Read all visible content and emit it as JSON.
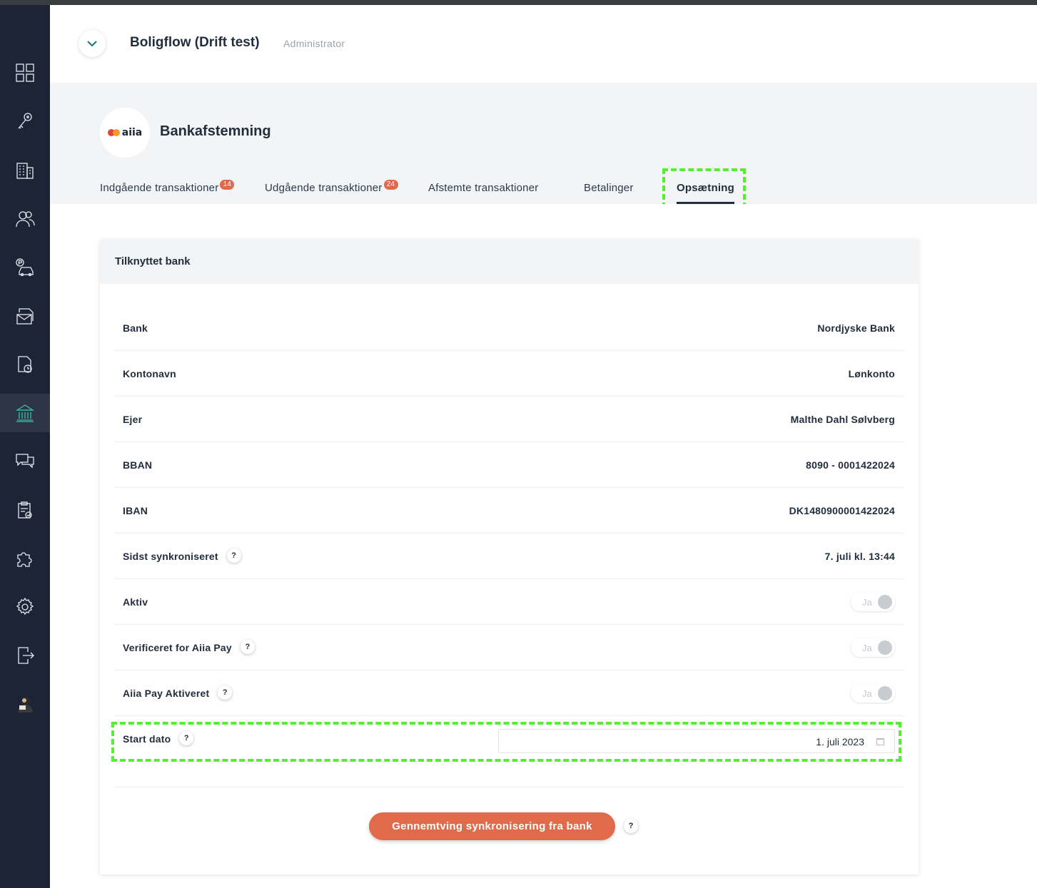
{
  "header": {
    "title": "Boligflow (Drift test)",
    "role": "Administrator"
  },
  "page": {
    "title": "Bankafstemning",
    "logo_text": "aiia",
    "brand_colors": {
      "dot1": "#e0453a",
      "dot2": "#f39a2b",
      "accent": "#df6a4c",
      "highlight": "#55ee33"
    }
  },
  "sidebar": {
    "items": [
      {
        "icon": "dashboard-grid-icon"
      },
      {
        "icon": "keys-icon"
      },
      {
        "icon": "building-icon"
      },
      {
        "icon": "users-icon"
      },
      {
        "icon": "parking-car-icon"
      },
      {
        "icon": "mail-stack-icon"
      },
      {
        "icon": "document-clock-icon"
      },
      {
        "icon": "bank-icon",
        "active": true
      },
      {
        "icon": "chat-icon"
      },
      {
        "icon": "clipboard-check-icon"
      },
      {
        "icon": "puzzle-icon"
      },
      {
        "icon": "gear-icon"
      },
      {
        "icon": "logout-icon"
      },
      {
        "icon": "avatar"
      }
    ]
  },
  "tabs": [
    {
      "label": "Indgående transaktioner",
      "badge": "14"
    },
    {
      "label": "Udgående transaktioner",
      "badge": "24"
    },
    {
      "label": "Afstemte transaktioner"
    },
    {
      "label": "Betalinger"
    },
    {
      "label": "Opsætning",
      "active": true
    }
  ],
  "card": {
    "title": "Tilknyttet bank",
    "rows": [
      {
        "label": "Bank",
        "value": "Nordjyske Bank"
      },
      {
        "label": "Kontonavn",
        "value": "Lønkonto"
      },
      {
        "label": "Ejer",
        "value": "Malthe Dahl Sølvberg"
      },
      {
        "label": "BBAN",
        "value": "8090 - 0001422024"
      },
      {
        "label": "IBAN",
        "value": "DK1480900001422024"
      },
      {
        "label": "Sidst synkroniseret",
        "value": "7. juli kl. 13:44",
        "help": "?"
      },
      {
        "label": "Aktiv",
        "toggle": "Ja"
      },
      {
        "label": "Verificeret for Aiia Pay",
        "toggle": "Ja",
        "help": "?"
      },
      {
        "label": "Aiia Pay Aktiveret",
        "toggle": "Ja",
        "help": "?"
      },
      {
        "label": "Start dato",
        "date": "1. juli 2023",
        "help": "?"
      }
    ],
    "sync_button": "Gennemtving synkronisering fra bank",
    "sync_help": "?"
  }
}
